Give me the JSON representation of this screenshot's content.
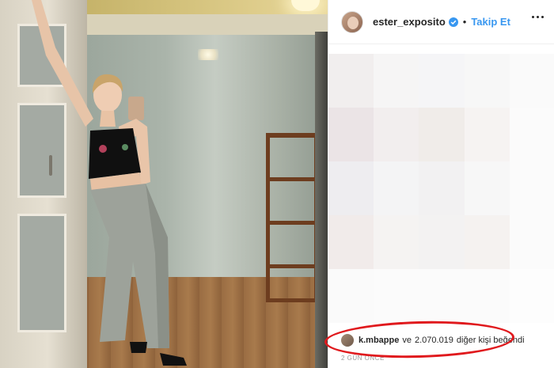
{
  "post": {
    "username": "ester_exposito",
    "follow_label": "Takip Et",
    "separator": "•"
  },
  "likes": {
    "liker_username": "k.mbappe",
    "connector": "ve",
    "count": "2.070.019",
    "suffix": "diğer kişi beğendi"
  },
  "time_ago": "2 GÜN ÖNCE",
  "colors": {
    "follow_blue": "#3897f0",
    "highlight_red": "#e0191d"
  },
  "pixel_colors": [
    "#f1eeee",
    "#f6f5f5",
    "#f5f5f7",
    "#f7f7f7",
    "#fafafa",
    "#ebe4e6",
    "#f2eeee",
    "#f0ece9",
    "#f6f3f2",
    "#fbfbfb",
    "#eeedf0",
    "#f4f4f5",
    "#f2f1f2",
    "#f7f7f7",
    "#fbfbfb",
    "#f1ebea",
    "#f5f3f2",
    "#f3f2f2",
    "#f5f2f0",
    "#fbfbfb",
    "#fafafa",
    "#fbfbfb",
    "#fbfbfb",
    "#fbfbfb",
    "#fdfdfd"
  ]
}
